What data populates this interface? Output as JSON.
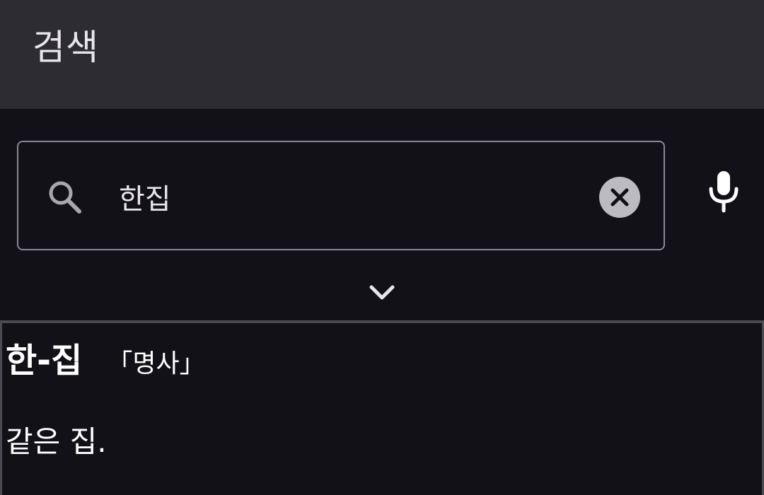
{
  "app_bar": {
    "title": "검색"
  },
  "search": {
    "value": "한집",
    "placeholder": "",
    "icon": "search-icon"
  },
  "controls": {
    "clear_icon": "close-icon",
    "mic_icon": "microphone-icon",
    "expand_icon": "chevron-down-icon"
  },
  "result": {
    "headword": "한-집",
    "part_of_speech": "「명사」",
    "definition": "같은 집."
  },
  "colors": {
    "app_bar_bg": "#2e2c33",
    "page_bg": "#131118",
    "text_primary": "#ffffff",
    "outline": "#8a8890"
  }
}
